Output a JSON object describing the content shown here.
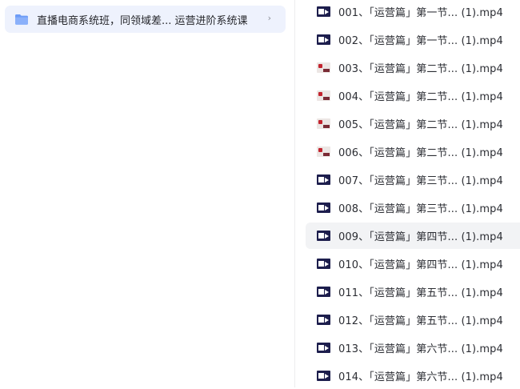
{
  "folder": {
    "name": "直播电商系统班，同领域差... 运营进阶系统课",
    "icon": "folder-icon",
    "chevron_icon": "chevron-right-icon",
    "chevron_glyph": "›"
  },
  "files": [
    {
      "name": "001、「运营篇」第一节... (1).mp4",
      "thumb": "video",
      "selected": false
    },
    {
      "name": "002、「运营篇」第一节... (1).mp4",
      "thumb": "video",
      "selected": false
    },
    {
      "name": "003、「运营篇」第二节... (1).mp4",
      "thumb": "photo",
      "selected": false
    },
    {
      "name": "004、「运营篇」第二节... (1).mp4",
      "thumb": "photo",
      "selected": false
    },
    {
      "name": "005、「运营篇」第二节... (1).mp4",
      "thumb": "photo",
      "selected": false
    },
    {
      "name": "006、「运营篇」第二节... (1).mp4",
      "thumb": "photo",
      "selected": false
    },
    {
      "name": "007、「运营篇」第三节... (1).mp4",
      "thumb": "video",
      "selected": false
    },
    {
      "name": "008、「运营篇」第三节... (1).mp4",
      "thumb": "video",
      "selected": false
    },
    {
      "name": "009、「运营篇」第四节... (1).mp4",
      "thumb": "video",
      "selected": true
    },
    {
      "name": "010、「运营篇」第四节... (1).mp4",
      "thumb": "video",
      "selected": false
    },
    {
      "name": "011、「运营篇」第五节... (1).mp4",
      "thumb": "video",
      "selected": false
    },
    {
      "name": "012、「运营篇」第五节... (1).mp4",
      "thumb": "video",
      "selected": false
    },
    {
      "name": "013、「运营篇」第六节... (1).mp4",
      "thumb": "video",
      "selected": false
    },
    {
      "name": "014、「运营篇」第六节... (1).mp4",
      "thumb": "video",
      "selected": false
    }
  ],
  "colors": {
    "folder_highlight": "#eef2fd",
    "folder_icon": "#6d9cf7",
    "selected_row": "#f2f3f5",
    "text": "#2b2d33"
  }
}
